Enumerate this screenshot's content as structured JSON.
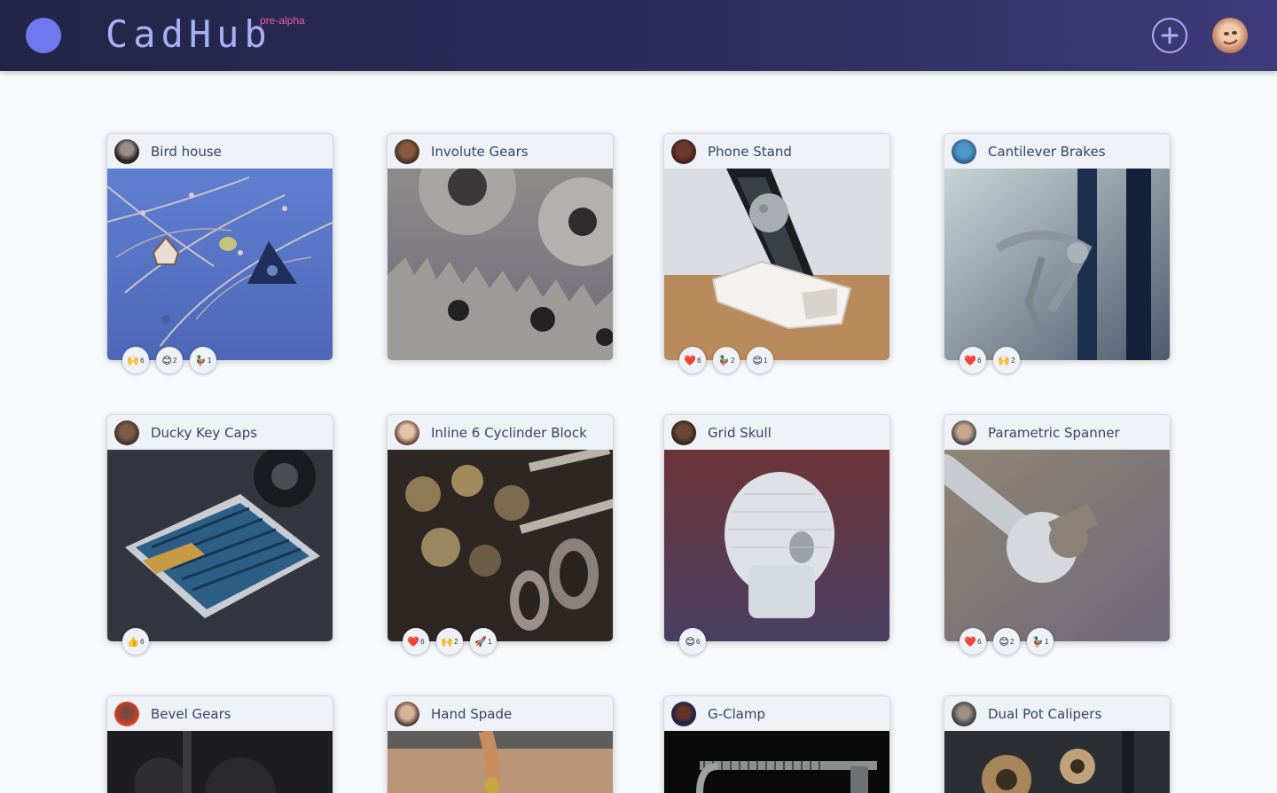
{
  "header": {
    "brand": "CadHub",
    "badge": "pre-alpha",
    "add_icon": "plus-circle-icon",
    "avatar_icon": "user-avatar"
  },
  "parts": [
    {
      "title": "Bird house",
      "reactions": [
        {
          "emoji": "🙌",
          "count": "6"
        },
        {
          "emoji": "😊",
          "count": "2"
        },
        {
          "emoji": "🦆",
          "count": "1"
        }
      ]
    },
    {
      "title": "Involute Gears",
      "reactions": []
    },
    {
      "title": "Phone Stand",
      "reactions": [
        {
          "emoji": "❤️",
          "count": "6"
        },
        {
          "emoji": "🦆",
          "count": "2"
        },
        {
          "emoji": "😊",
          "count": "1"
        }
      ]
    },
    {
      "title": "Cantilever Brakes",
      "reactions": [
        {
          "emoji": "❤️",
          "count": "6"
        },
        {
          "emoji": "🙌",
          "count": "2"
        }
      ]
    },
    {
      "title": "Ducky Key Caps",
      "reactions": [
        {
          "emoji": "👍",
          "count": "6"
        }
      ]
    },
    {
      "title": "Inline 6 Cyclinder Block",
      "reactions": [
        {
          "emoji": "❤️",
          "count": "6"
        },
        {
          "emoji": "🙌",
          "count": "2"
        },
        {
          "emoji": "🚀",
          "count": "1"
        }
      ]
    },
    {
      "title": "Grid Skull",
      "reactions": [
        {
          "emoji": "😊",
          "count": "6"
        }
      ]
    },
    {
      "title": "Parametric Spanner",
      "reactions": [
        {
          "emoji": "❤️",
          "count": "6"
        },
        {
          "emoji": "😊",
          "count": "2"
        },
        {
          "emoji": "🦆",
          "count": "1"
        }
      ]
    },
    {
      "title": "Bevel Gears",
      "reactions": []
    },
    {
      "title": "Hand Spade",
      "reactions": []
    },
    {
      "title": "G-Clamp",
      "reactions": []
    },
    {
      "title": "Dual Pot Calipers",
      "reactions": []
    }
  ]
}
